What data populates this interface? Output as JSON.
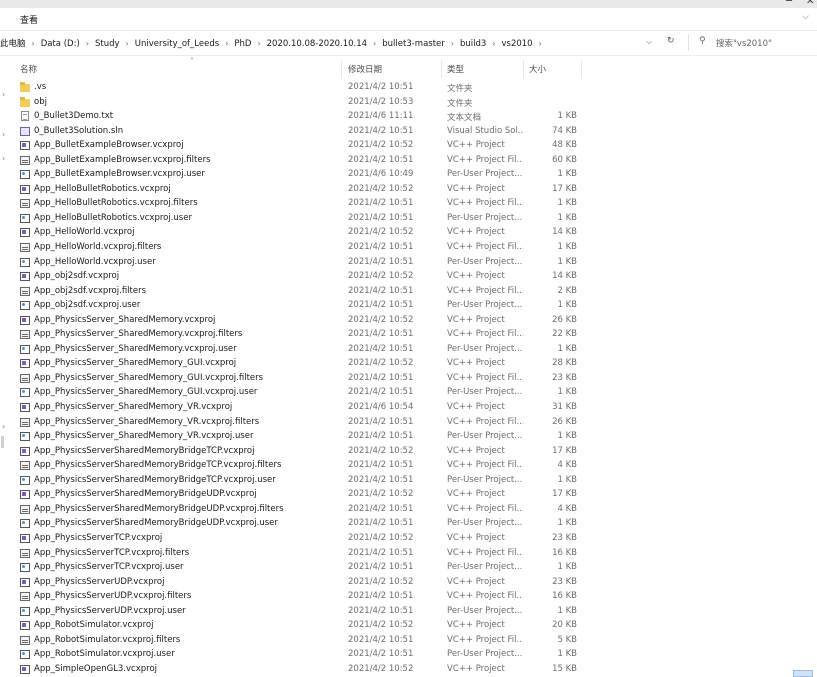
{
  "window": {
    "minimize": "─",
    "close": "✕"
  },
  "ribbon": {
    "tab": "查看",
    "expand": "⌵"
  },
  "address": {
    "crumbs": [
      "此电脑",
      "Data (D:)",
      "Study",
      "University_of_Leeds",
      "PhD",
      "2020.10.08-2020.10.14",
      "bullet3-master",
      "build3",
      "vs2010"
    ],
    "separator": "›",
    "dropdown": "⌵",
    "refresh": "↻"
  },
  "search": {
    "placeholder": "搜索\"vs2010\"",
    "icon": "search-icon"
  },
  "columns": {
    "name": "名称",
    "date": "修改日期",
    "type": "类型",
    "size": "大小",
    "sort": "˄"
  },
  "files": [
    {
      "name": ".vs",
      "date": "2021/4/2 10:51",
      "type": "文件夹",
      "size": "",
      "icon": "folder"
    },
    {
      "name": "obj",
      "date": "2021/4/2 10:53",
      "type": "文件夹",
      "size": "",
      "icon": "folder"
    },
    {
      "name": "0_Bullet3Demo.txt",
      "date": "2021/4/6 11:11",
      "type": "文本文档",
      "size": "1 KB",
      "icon": "txt"
    },
    {
      "name": "0_Bullet3Solution.sln",
      "date": "2021/4/2 10:51",
      "type": "Visual Studio Sol...",
      "size": "74 KB",
      "icon": "sln"
    },
    {
      "name": "App_BulletExampleBrowser.vcxproj",
      "date": "2021/4/2 10:52",
      "type": "VC++ Project",
      "size": "48 KB",
      "icon": "proj"
    },
    {
      "name": "App_BulletExampleBrowser.vcxproj.filters",
      "date": "2021/4/2 10:51",
      "type": "VC++ Project Fil...",
      "size": "60 KB",
      "icon": "filt"
    },
    {
      "name": "App_BulletExampleBrowser.vcxproj.user",
      "date": "2021/4/6 10:49",
      "type": "Per-User Project...",
      "size": "1 KB",
      "icon": "user"
    },
    {
      "name": "App_HelloBulletRobotics.vcxproj",
      "date": "2021/4/2 10:52",
      "type": "VC++ Project",
      "size": "17 KB",
      "icon": "proj"
    },
    {
      "name": "App_HelloBulletRobotics.vcxproj.filters",
      "date": "2021/4/2 10:51",
      "type": "VC++ Project Fil...",
      "size": "1 KB",
      "icon": "filt"
    },
    {
      "name": "App_HelloBulletRobotics.vcxproj.user",
      "date": "2021/4/2 10:51",
      "type": "Per-User Project...",
      "size": "1 KB",
      "icon": "user"
    },
    {
      "name": "App_HelloWorld.vcxproj",
      "date": "2021/4/2 10:52",
      "type": "VC++ Project",
      "size": "14 KB",
      "icon": "proj"
    },
    {
      "name": "App_HelloWorld.vcxproj.filters",
      "date": "2021/4/2 10:51",
      "type": "VC++ Project Fil...",
      "size": "1 KB",
      "icon": "filt"
    },
    {
      "name": "App_HelloWorld.vcxproj.user",
      "date": "2021/4/2 10:51",
      "type": "Per-User Project...",
      "size": "1 KB",
      "icon": "user"
    },
    {
      "name": "App_obj2sdf.vcxproj",
      "date": "2021/4/2 10:52",
      "type": "VC++ Project",
      "size": "14 KB",
      "icon": "proj"
    },
    {
      "name": "App_obj2sdf.vcxproj.filters",
      "date": "2021/4/2 10:51",
      "type": "VC++ Project Fil...",
      "size": "2 KB",
      "icon": "filt"
    },
    {
      "name": "App_obj2sdf.vcxproj.user",
      "date": "2021/4/2 10:51",
      "type": "Per-User Project...",
      "size": "1 KB",
      "icon": "user"
    },
    {
      "name": "App_PhysicsServer_SharedMemory.vcxproj",
      "date": "2021/4/2 10:52",
      "type": "VC++ Project",
      "size": "26 KB",
      "icon": "proj"
    },
    {
      "name": "App_PhysicsServer_SharedMemory.vcxproj.filters",
      "date": "2021/4/2 10:51",
      "type": "VC++ Project Fil...",
      "size": "22 KB",
      "icon": "filt"
    },
    {
      "name": "App_PhysicsServer_SharedMemory.vcxproj.user",
      "date": "2021/4/2 10:51",
      "type": "Per-User Project...",
      "size": "1 KB",
      "icon": "user"
    },
    {
      "name": "App_PhysicsServer_SharedMemory_GUI.vcxproj",
      "date": "2021/4/2 10:52",
      "type": "VC++ Project",
      "size": "28 KB",
      "icon": "proj"
    },
    {
      "name": "App_PhysicsServer_SharedMemory_GUI.vcxproj.filters",
      "date": "2021/4/2 10:51",
      "type": "VC++ Project Fil...",
      "size": "23 KB",
      "icon": "filt"
    },
    {
      "name": "App_PhysicsServer_SharedMemory_GUI.vcxproj.user",
      "date": "2021/4/2 10:51",
      "type": "Per-User Project...",
      "size": "1 KB",
      "icon": "user"
    },
    {
      "name": "App_PhysicsServer_SharedMemory_VR.vcxproj",
      "date": "2021/4/6 10:54",
      "type": "VC++ Project",
      "size": "31 KB",
      "icon": "proj"
    },
    {
      "name": "App_PhysicsServer_SharedMemory_VR.vcxproj.filters",
      "date": "2021/4/2 10:51",
      "type": "VC++ Project Fil...",
      "size": "26 KB",
      "icon": "filt"
    },
    {
      "name": "App_PhysicsServer_SharedMemory_VR.vcxproj.user",
      "date": "2021/4/2 10:51",
      "type": "Per-User Project...",
      "size": "1 KB",
      "icon": "user"
    },
    {
      "name": "App_PhysicsServerSharedMemoryBridgeTCP.vcxproj",
      "date": "2021/4/2 10:52",
      "type": "VC++ Project",
      "size": "17 KB",
      "icon": "proj"
    },
    {
      "name": "App_PhysicsServerSharedMemoryBridgeTCP.vcxproj.filters",
      "date": "2021/4/2 10:51",
      "type": "VC++ Project Fil...",
      "size": "4 KB",
      "icon": "filt"
    },
    {
      "name": "App_PhysicsServerSharedMemoryBridgeTCP.vcxproj.user",
      "date": "2021/4/2 10:51",
      "type": "Per-User Project...",
      "size": "1 KB",
      "icon": "user"
    },
    {
      "name": "App_PhysicsServerSharedMemoryBridgeUDP.vcxproj",
      "date": "2021/4/2 10:52",
      "type": "VC++ Project",
      "size": "17 KB",
      "icon": "proj"
    },
    {
      "name": "App_PhysicsServerSharedMemoryBridgeUDP.vcxproj.filters",
      "date": "2021/4/2 10:51",
      "type": "VC++ Project Fil...",
      "size": "4 KB",
      "icon": "filt"
    },
    {
      "name": "App_PhysicsServerSharedMemoryBridgeUDP.vcxproj.user",
      "date": "2021/4/2 10:51",
      "type": "Per-User Project...",
      "size": "1 KB",
      "icon": "user"
    },
    {
      "name": "App_PhysicsServerTCP.vcxproj",
      "date": "2021/4/2 10:52",
      "type": "VC++ Project",
      "size": "23 KB",
      "icon": "proj"
    },
    {
      "name": "App_PhysicsServerTCP.vcxproj.filters",
      "date": "2021/4/2 10:51",
      "type": "VC++ Project Fil...",
      "size": "16 KB",
      "icon": "filt"
    },
    {
      "name": "App_PhysicsServerTCP.vcxproj.user",
      "date": "2021/4/2 10:51",
      "type": "Per-User Project...",
      "size": "1 KB",
      "icon": "user"
    },
    {
      "name": "App_PhysicsServerUDP.vcxproj",
      "date": "2021/4/2 10:52",
      "type": "VC++ Project",
      "size": "23 KB",
      "icon": "proj"
    },
    {
      "name": "App_PhysicsServerUDP.vcxproj.filters",
      "date": "2021/4/2 10:51",
      "type": "VC++ Project Fil...",
      "size": "16 KB",
      "icon": "filt"
    },
    {
      "name": "App_PhysicsServerUDP.vcxproj.user",
      "date": "2021/4/2 10:51",
      "type": "Per-User Project...",
      "size": "1 KB",
      "icon": "user"
    },
    {
      "name": "App_RobotSimulator.vcxproj",
      "date": "2021/4/2 10:52",
      "type": "VC++ Project",
      "size": "20 KB",
      "icon": "proj"
    },
    {
      "name": "App_RobotSimulator.vcxproj.filters",
      "date": "2021/4/2 10:51",
      "type": "VC++ Project Fil...",
      "size": "5 KB",
      "icon": "filt"
    },
    {
      "name": "App_RobotSimulator.vcxproj.user",
      "date": "2021/4/2 10:51",
      "type": "Per-User Project...",
      "size": "1 KB",
      "icon": "user"
    },
    {
      "name": "App_SimpleOpenGL3.vcxproj",
      "date": "2021/4/2 10:52",
      "type": "VC++ Project",
      "size": "15 KB",
      "icon": "proj"
    }
  ]
}
